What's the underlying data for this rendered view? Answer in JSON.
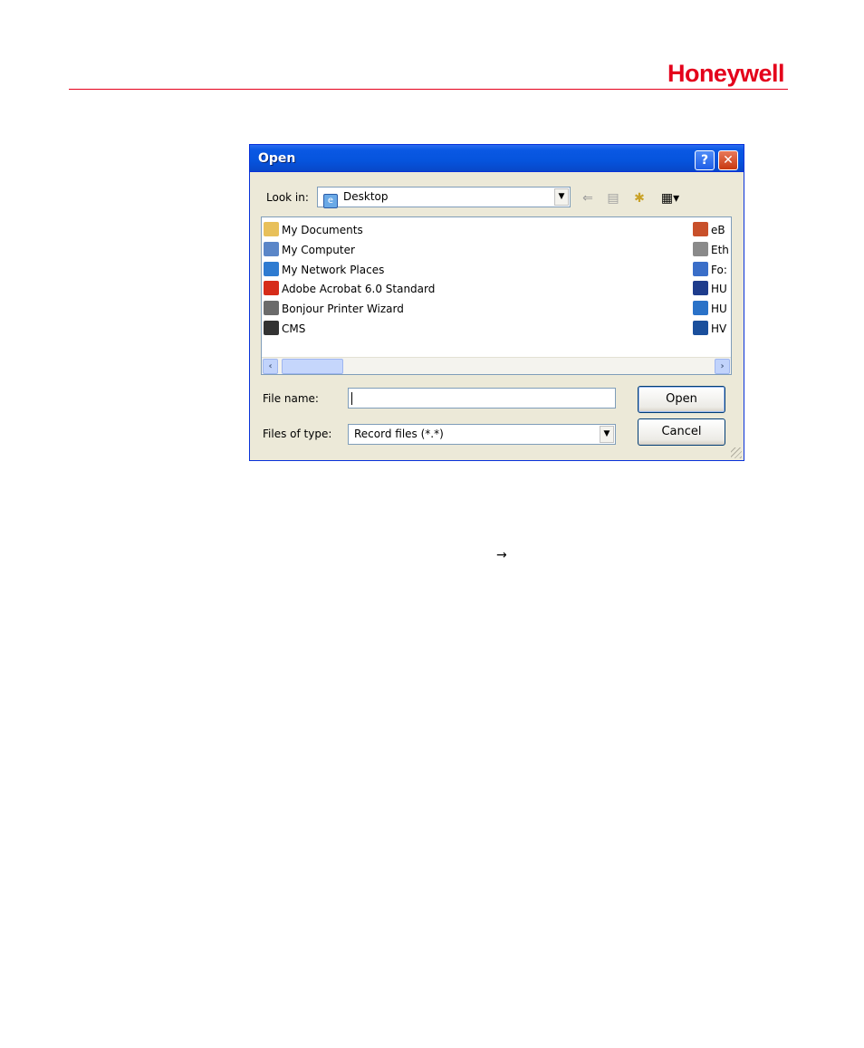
{
  "brand": "Honeywell",
  "dialog": {
    "title": "Open",
    "help_label": "?",
    "close_label": "✕",
    "look_in_label": "Look in:",
    "look_in_value": "Desktop",
    "files_left": [
      {
        "label": "My Documents",
        "icon": "my-documents-icon",
        "color": "#e8c05a"
      },
      {
        "label": "My Computer",
        "icon": "my-computer-icon",
        "color": "#5a86c8"
      },
      {
        "label": "My Network Places",
        "icon": "network-places-icon",
        "color": "#2e7bd1"
      },
      {
        "label": "Adobe Acrobat 6.0 Standard",
        "icon": "acrobat-icon",
        "color": "#d62c1a"
      },
      {
        "label": "Bonjour Printer Wizard",
        "icon": "printer-icon",
        "color": "#6b6b6b"
      },
      {
        "label": "CMS",
        "icon": "cms-icon",
        "color": "#333333"
      }
    ],
    "files_right": [
      {
        "label": "eB",
        "icon": "eb-shortcut-icon",
        "color": "#c8502a"
      },
      {
        "label": "Eth",
        "icon": "ethereal-icon",
        "color": "#8a8a8a"
      },
      {
        "label": "Fo:",
        "icon": "fo-shortcut-icon",
        "color": "#3a6ec8"
      },
      {
        "label": "HU",
        "icon": "hu-window-icon",
        "color": "#1e3c8c"
      },
      {
        "label": "HU",
        "icon": "hu-globe-icon",
        "color": "#2a72c8"
      },
      {
        "label": "HV",
        "icon": "hv-shortcut-icon",
        "color": "#1a4f9c"
      }
    ],
    "file_name_label": "File name:",
    "file_name_value": "",
    "files_of_type_label": "Files of type:",
    "files_of_type_value": "Record files (*.*)",
    "open_label": "Open",
    "cancel_label": "Cancel"
  },
  "arrow_text": "→"
}
